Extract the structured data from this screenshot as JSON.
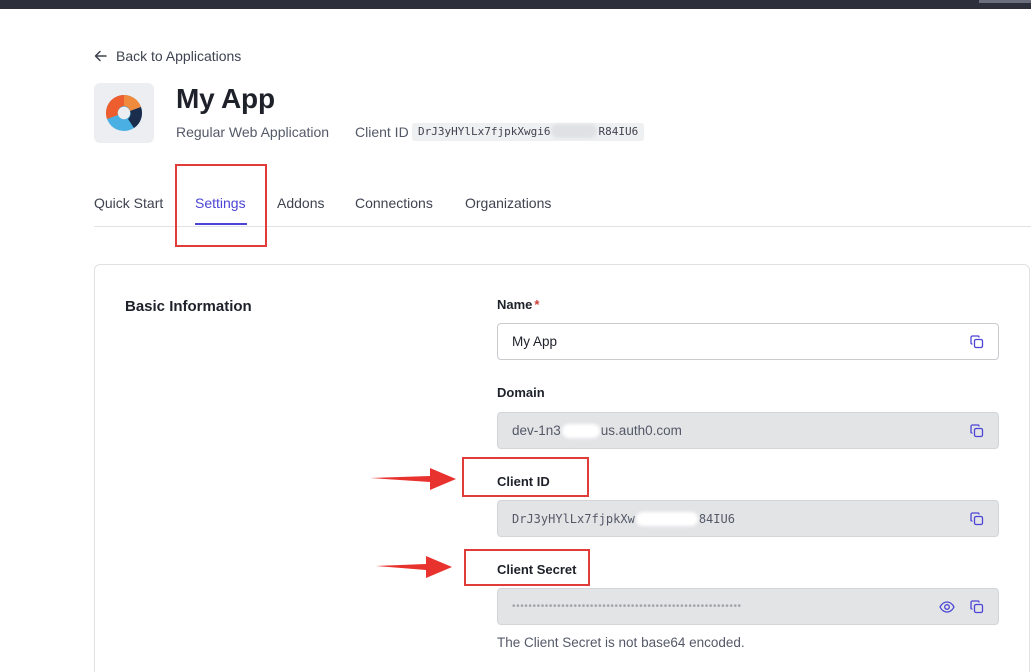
{
  "back_link": {
    "label": "Back to Applications"
  },
  "app": {
    "name": "My App",
    "type": "Regular Web Application",
    "client_id_label": "Client ID",
    "client_id_start": "DrJ3yHYlLx7fjpkXwgi6",
    "client_id_end": "R84IU6"
  },
  "tabs": [
    {
      "label": "Quick Start"
    },
    {
      "label": "Settings",
      "active": true
    },
    {
      "label": "Addons"
    },
    {
      "label": "Connections"
    },
    {
      "label": "Organizations"
    }
  ],
  "basic_info": {
    "title": "Basic Information",
    "name": {
      "label": "Name",
      "required_mark": "*",
      "value": "My App",
      "copy_icon": "copy-icon"
    },
    "domain": {
      "label": "Domain",
      "value_start": "dev-1n3",
      "value_end": "us.auth0.com",
      "copy_icon": "copy-icon"
    },
    "client_id": {
      "label": "Client ID",
      "value_start": "DrJ3yHYlLx7fjpkXw",
      "value_end": "84IU6",
      "copy_icon": "copy-icon"
    },
    "client_secret": {
      "label": "Client Secret",
      "masked_value": "••••••••••••••••••••••••••••••••••••••••••••••••••••••••",
      "reveal_icon": "eye-icon",
      "copy_icon": "copy-icon",
      "hint": "The Client Secret is not base64 encoded."
    }
  },
  "colors": {
    "accent": "#4b44d6",
    "annotation": "#e03d3a",
    "topbar": "#2d2f3b"
  }
}
